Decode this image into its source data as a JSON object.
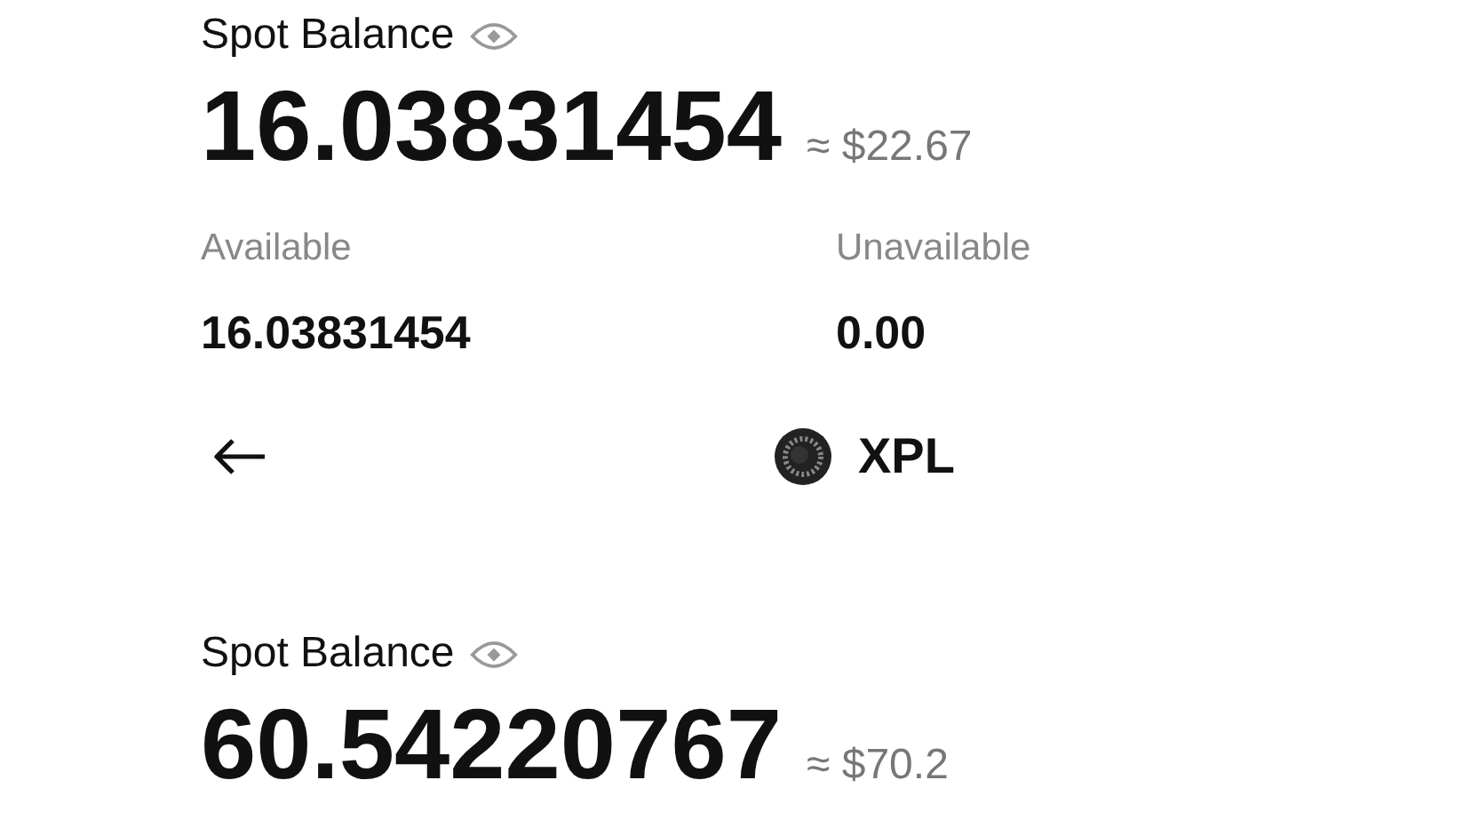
{
  "balance_top": {
    "label": "Spot Balance",
    "amount": "16.03831454",
    "fiat": "≈ $22.67"
  },
  "details": [
    {
      "label": "Available",
      "value": "16.03831454"
    },
    {
      "label": "Unavailable",
      "value": "0.00"
    }
  ],
  "header": {
    "title": "XPL"
  },
  "balance_bottom": {
    "label": "Spot Balance",
    "amount": "60.54220767",
    "fiat": "≈ $70.2"
  }
}
